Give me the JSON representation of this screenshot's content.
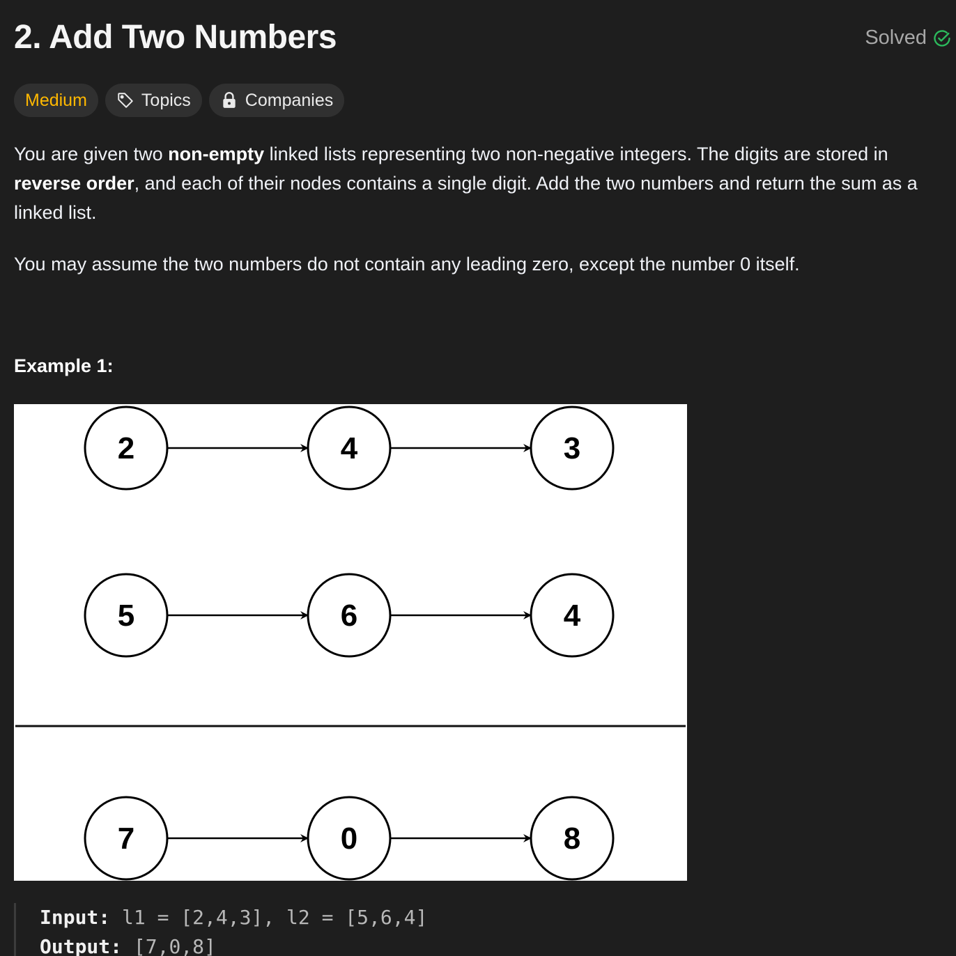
{
  "header": {
    "title": "2. Add Two Numbers",
    "status": "Solved"
  },
  "tags": {
    "difficulty": "Medium",
    "topics": "Topics",
    "companies": "Companies"
  },
  "description": {
    "p1": {
      "t1": "You are given two ",
      "b1": "non-empty",
      "t2": " linked lists representing two non-negative integers. The digits are stored in ",
      "b2": "reverse order",
      "t3": ", and each of their nodes contains a single digit. Add the two numbers and return the sum as a linked list."
    },
    "p2": "You may assume the two numbers do not contain any leading zero, except the number 0 itself."
  },
  "example": {
    "title": "Example 1:",
    "diagram": {
      "list1": [
        "2",
        "4",
        "3"
      ],
      "list2": [
        "5",
        "6",
        "4"
      ],
      "result": [
        "7",
        "0",
        "8"
      ]
    },
    "input_label": "Input:",
    "input_value": "l1 = [2,4,3], l2 = [5,6,4]",
    "output_label": "Output:",
    "output_value": "[7,0,8]"
  },
  "colors": {
    "background": "#1e1e1e",
    "medium": "#ffb800",
    "solved_check": "#2cbb5d",
    "tag_bg": "#303030"
  },
  "icons": {
    "solved": "check-circle-icon",
    "topics": "tag-icon",
    "companies": "lock-icon"
  }
}
